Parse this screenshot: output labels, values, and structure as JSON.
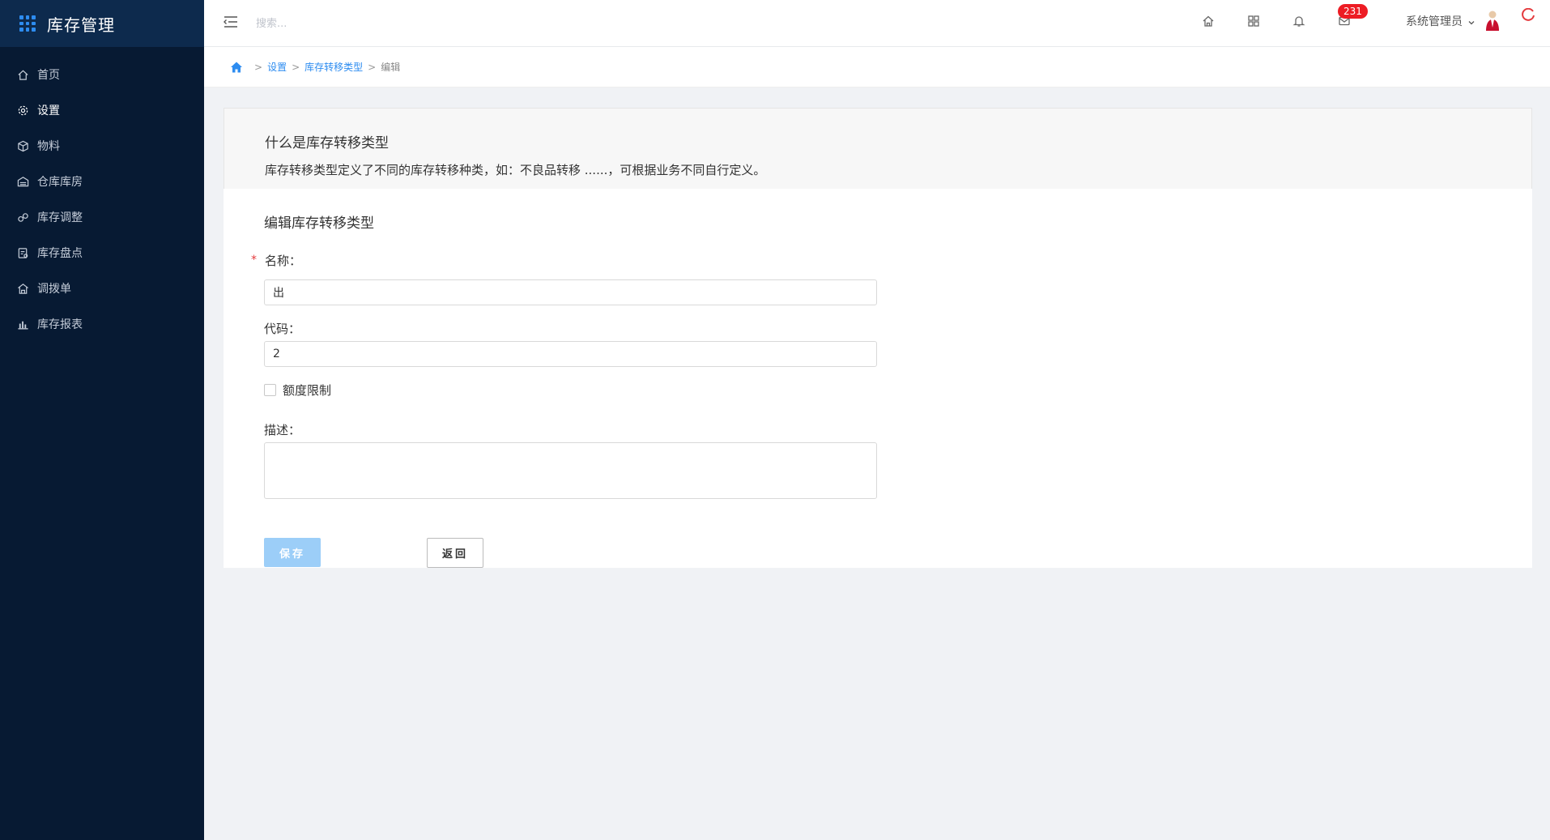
{
  "brand": {
    "title": "库存管理"
  },
  "sidebar": {
    "items": [
      {
        "label": "首页",
        "icon": "home-icon",
        "active": false
      },
      {
        "label": "设置",
        "icon": "gear-icon",
        "active": true
      },
      {
        "label": "物料",
        "icon": "cube-icon",
        "active": false
      },
      {
        "label": "仓库库房",
        "icon": "warehouse-icon",
        "active": false
      },
      {
        "label": "库存调整",
        "icon": "adjust-icon",
        "active": false
      },
      {
        "label": "库存盘点",
        "icon": "inventory-icon",
        "active": false
      },
      {
        "label": "调拨单",
        "icon": "transfer-icon",
        "active": false
      },
      {
        "label": "库存报表",
        "icon": "bar-chart-icon",
        "active": false
      }
    ]
  },
  "header": {
    "search_placeholder": "搜索...",
    "badge_count": "231",
    "user_name": "系统管理员"
  },
  "breadcrumb": {
    "settings": "设置",
    "types": "库存转移类型",
    "current": "编辑",
    "sep": ">"
  },
  "intro": {
    "title": "什么是库存转移类型",
    "description": "库存转移类型定义了不同的库存转移种类，如：不良品转移 ......，可根据业务不同自行定义。"
  },
  "form": {
    "title": "编辑库存转移类型",
    "required_mark": "*",
    "name_label": "名称：",
    "name_value": "出",
    "code_label": "代码：",
    "code_value": "2",
    "quota_label": "额度限制",
    "quota_checked": false,
    "desc_label": "描述：",
    "desc_value": "",
    "save_label": "保存",
    "back_label": "返回"
  },
  "colors": {
    "sidebar_bg": "#071a33",
    "accent": "#2d8cf0",
    "badge": "#ed1c24",
    "save_button": "#9ccef8"
  }
}
